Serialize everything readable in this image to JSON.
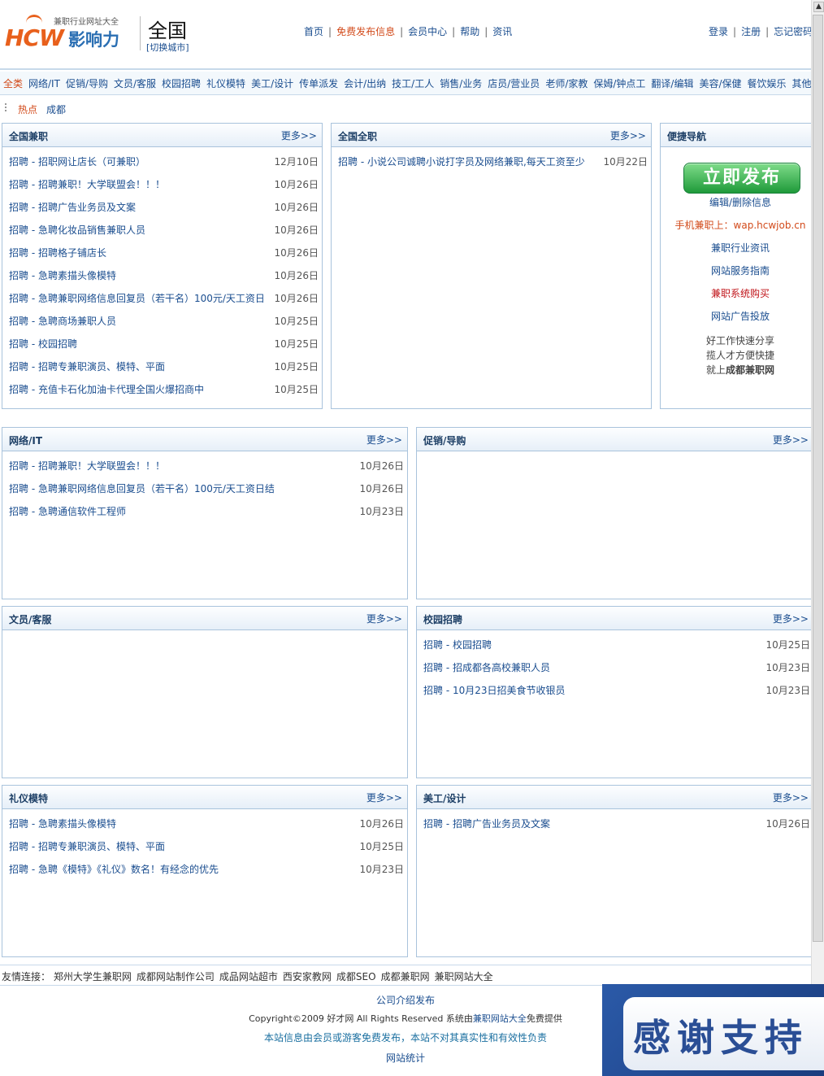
{
  "header": {
    "tagline": "兼职行业网址大全",
    "logo_text": "HCW",
    "logo_brand": "影响力",
    "city": "全国",
    "switch_city": "[切换城市]",
    "nav": [
      "首页",
      "免费发布信息",
      "会员中心",
      "帮助",
      "资讯"
    ],
    "user_nav": [
      "登录",
      "注册",
      "忘记密码"
    ]
  },
  "categories": [
    "全类",
    "网络/IT",
    "促销/导购",
    "文员/客服",
    "校园招聘",
    "礼仪模特",
    "美工/设计",
    "传单派发",
    "会计/出纳",
    "技工/工人",
    "销售/业务",
    "店员/营业员",
    "老师/家教",
    "保姆/钟点工",
    "翻译/编辑",
    "美容/保健",
    "餐饮娱乐",
    "其他"
  ],
  "hot": {
    "label": "热点",
    "city": "成都"
  },
  "more": "更多>>",
  "boxes": {
    "national_parttime": {
      "title": "全国兼职",
      "items": [
        {
          "title": "招聘 - 招职网让店长（可兼职）",
          "date": "12月10日"
        },
        {
          "title": "招聘 - 招聘兼职！大学联盟会！！！",
          "date": "10月26日"
        },
        {
          "title": "招聘 - 招聘广告业务员及文案",
          "date": "10月26日"
        },
        {
          "title": "招聘 - 急聘化妆品销售兼职人员",
          "date": "10月26日"
        },
        {
          "title": "招聘 - 招聘格子铺店长",
          "date": "10月26日"
        },
        {
          "title": "招聘 - 急聘素描头像模特",
          "date": "10月26日"
        },
        {
          "title": "招聘 - 急聘兼职网络信息回复员（若干名）100元/天工资日",
          "date": "10月26日"
        },
        {
          "title": "招聘 - 急聘商场兼职人员",
          "date": "10月25日"
        },
        {
          "title": "招聘 - 校园招聘",
          "date": "10月25日"
        },
        {
          "title": "招聘 - 招聘专兼职演员、模特、平面",
          "date": "10月25日"
        },
        {
          "title": "招聘 - 充值卡石化加油卡代理全国火爆招商中",
          "date": "10月25日"
        }
      ]
    },
    "national_fulltime": {
      "title": "全国全职",
      "items": [
        {
          "title": "招聘 - 小说公司诚聘小说打字员及网络兼职,每天工资至少",
          "date": "10月22日"
        }
      ]
    },
    "quick_nav": {
      "title": "便捷导航",
      "publish": "立即发布",
      "edit": "编辑/删除信息",
      "mobile": "手机兼职上：wap.hcwjob.cn",
      "news": "兼职行业资讯",
      "guide": "网站服务指南",
      "buy": "兼职系统购买",
      "ads": "网站广告投放",
      "slogan1": "好工作快速分享",
      "slogan2": "揽人才方便快捷",
      "slogan3_pre": "就上",
      "slogan3_brand": "成都兼职网"
    },
    "network_it": {
      "title": "网络/IT",
      "items": [
        {
          "title": "招聘 - 招聘兼职！大学联盟会！！！",
          "date": "10月26日"
        },
        {
          "title": "招聘 - 急聘兼职网络信息回复员（若干名）100元/天工资日结",
          "date": "10月26日"
        },
        {
          "title": "招聘 - 急聘通信软件工程师",
          "date": "10月23日"
        }
      ]
    },
    "promotion": {
      "title": "促销/导购",
      "items": []
    },
    "clerk": {
      "title": "文员/客服",
      "items": []
    },
    "campus": {
      "title": "校园招聘",
      "items": [
        {
          "title": "招聘 - 校园招聘",
          "date": "10月25日"
        },
        {
          "title": "招聘 - 招成都各高校兼职人员",
          "date": "10月23日"
        },
        {
          "title": "招聘 - 10月23日招美食节收银员",
          "date": "10月23日"
        }
      ]
    },
    "etiquette": {
      "title": "礼仪模特",
      "items": [
        {
          "title": "招聘 - 急聘素描头像模特",
          "date": "10月26日"
        },
        {
          "title": "招聘 - 招聘专兼职演员、模特、平面",
          "date": "10月25日"
        },
        {
          "title": "招聘 - 急聘《模特》《礼仪》数名！有经念的优先",
          "date": "10月23日"
        }
      ]
    },
    "design": {
      "title": "美工/设计",
      "items": [
        {
          "title": "招聘 - 招聘广告业务员及文案",
          "date": "10月26日"
        }
      ]
    }
  },
  "friend_links": {
    "label": "友情连接：",
    "items": [
      "郑州大学生兼职网",
      "成都网站制作公司",
      "成品网站超市",
      "西安家教网",
      "成都SEO",
      "成都兼职网",
      "兼职网站大全"
    ]
  },
  "footer": {
    "about": "公司介绍发布",
    "copyright_pre": "Copyright©2009 好才网 All Rights Reserved 系统由",
    "copyright_brand": "兼职网站大全",
    "copyright_post": "免费提供",
    "notice": "本站信息由会员或游客免费发布，本站不对其真实性和有效性负责",
    "stats": "网站统计"
  },
  "banner": {
    "text": "感谢支持"
  },
  "colors": {
    "link": "#1a4d8f",
    "accent": "#d24a1a",
    "border": "#a9c3dc",
    "button": "#1f9a3a"
  }
}
